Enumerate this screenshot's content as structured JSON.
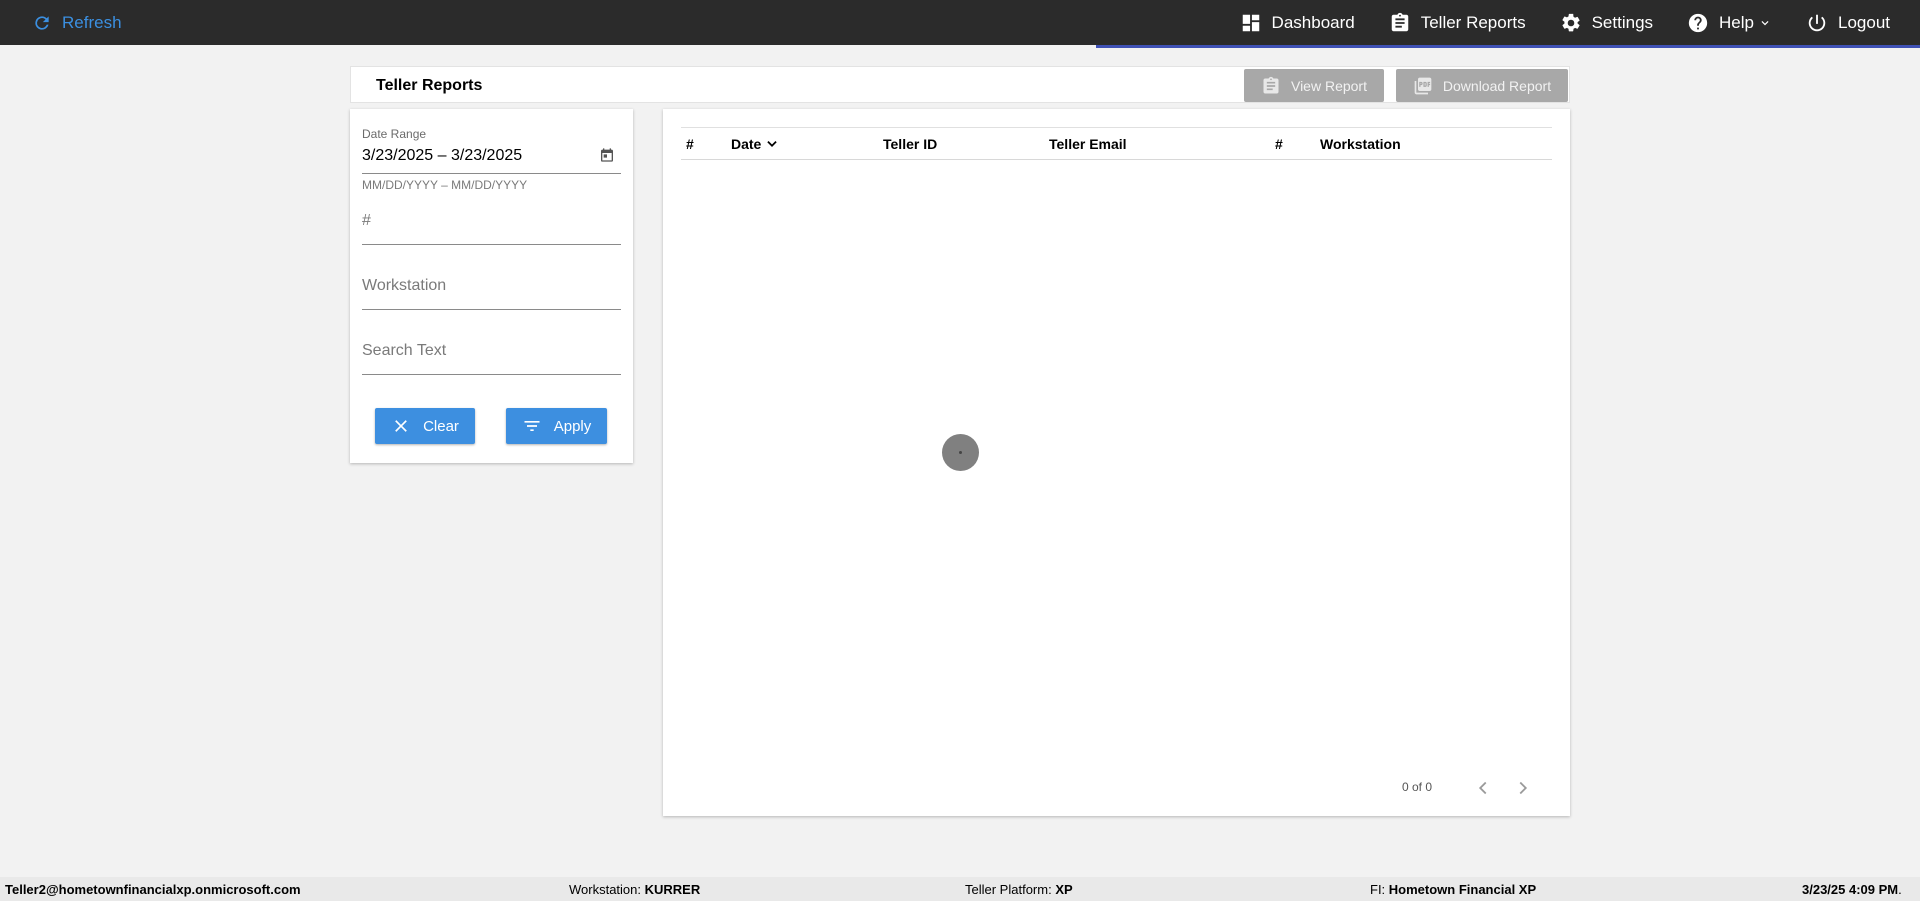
{
  "topbar": {
    "refresh_label": "Refresh",
    "nav": {
      "dashboard": "Dashboard",
      "teller_reports": "Teller Reports",
      "settings": "Settings",
      "help": "Help",
      "logout": "Logout"
    }
  },
  "page": {
    "title": "Teller Reports",
    "view_report_label": "View Report",
    "download_report_label": "Download Report"
  },
  "filters": {
    "date_range_label": "Date Range",
    "date_range_value": "3/23/2025 – 3/23/2025",
    "date_range_hint": "MM/DD/YYYY – MM/DD/YYYY",
    "number_placeholder": "#",
    "workstation_placeholder": "Workstation",
    "search_placeholder": "Search Text",
    "clear_label": "Clear",
    "apply_label": "Apply"
  },
  "table": {
    "columns": [
      "#",
      "Date",
      "Teller ID",
      "Teller Email",
      "#",
      "Workstation"
    ],
    "rows": [],
    "pagination": "0 of 0"
  },
  "footer": {
    "user": "Teller2@hometownfinancialxp.onmicrosoft.com",
    "workstation_label": "Workstation: ",
    "workstation_value": "KURRER",
    "platform_label": "Teller Platform: ",
    "platform_value": "XP",
    "fi_label": "FI: ",
    "fi_value": "Hometown Financial XP",
    "datetime": "3/23/25 4:09 PM",
    "datetime_suffix": "."
  },
  "colors": {
    "topbar": "#2b2b2b",
    "accent": "#3d8fe0",
    "progress": "#3f51b5",
    "disabled_button": "#a8a8a8"
  }
}
